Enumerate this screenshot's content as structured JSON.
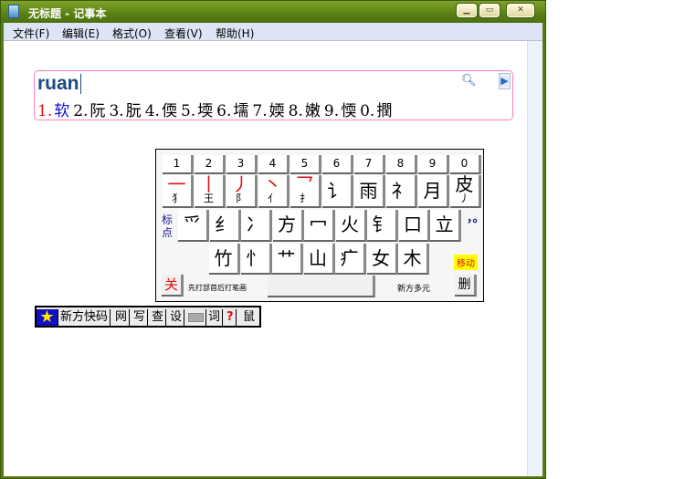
{
  "window": {
    "title": "无标题 - 记事本",
    "controls": [
      "minimize",
      "maximize",
      "close"
    ]
  },
  "menu": [
    "文件(F)",
    "编辑(E)",
    "格式(O)",
    "查看(V)",
    "帮助(H)"
  ],
  "ime": {
    "composition": "ruan",
    "candidates": [
      {
        "n": "1.",
        "c": "软"
      },
      {
        "n": "2.",
        "c": "阮"
      },
      {
        "n": "3.",
        "c": "朊"
      },
      {
        "n": "4.",
        "c": "偄"
      },
      {
        "n": "5.",
        "c": "堧"
      },
      {
        "n": "6.",
        "c": "壖"
      },
      {
        "n": "7.",
        "c": "媆"
      },
      {
        "n": "8.",
        "c": "嫩"
      },
      {
        "n": "9.",
        "c": "愞"
      },
      {
        "n": "0.",
        "c": "撋"
      }
    ],
    "colors": {
      "selected_number": "#e01010",
      "selected_char": "#1010e0",
      "border": "#ff7fbf"
    }
  },
  "keyboard": {
    "numbers": [
      "1",
      "2",
      "3",
      "4",
      "5",
      "6",
      "7",
      "8",
      "9",
      "0"
    ],
    "row2": [
      {
        "m": "一",
        "s": "犭",
        "red": true
      },
      {
        "m": "丨",
        "s": "王",
        "red": true
      },
      {
        "m": "丿",
        "s": "阝",
        "red": true
      },
      {
        "m": "丶",
        "s": "亻",
        "red": true
      },
      {
        "m": "乛",
        "s": "扌",
        "red": true
      },
      {
        "m": "讠",
        "s": ""
      },
      {
        "m": "雨",
        "s": ""
      },
      {
        "m": "礻",
        "s": ""
      },
      {
        "m": "月",
        "s": ""
      },
      {
        "m": "皮",
        "s": "丿"
      }
    ],
    "punct_label": "标点",
    "row3": [
      "爫",
      "纟",
      "冫",
      "方",
      "冖",
      "火",
      "钅",
      "口",
      "立"
    ],
    "punct_keys": "，。",
    "row4": [
      "竹",
      "忄",
      "艹",
      "山",
      "疒",
      "女",
      "木"
    ],
    "move": "移动",
    "close": "关",
    "hint": "先打部首后打笔画",
    "scheme": "新方多元",
    "delete": "删"
  },
  "status_bar": {
    "logo": "star-icon",
    "name": "新方快码",
    "items": [
      "网",
      "写",
      "查",
      "设",
      "keyboard",
      "词",
      "?",
      "鼠"
    ]
  }
}
